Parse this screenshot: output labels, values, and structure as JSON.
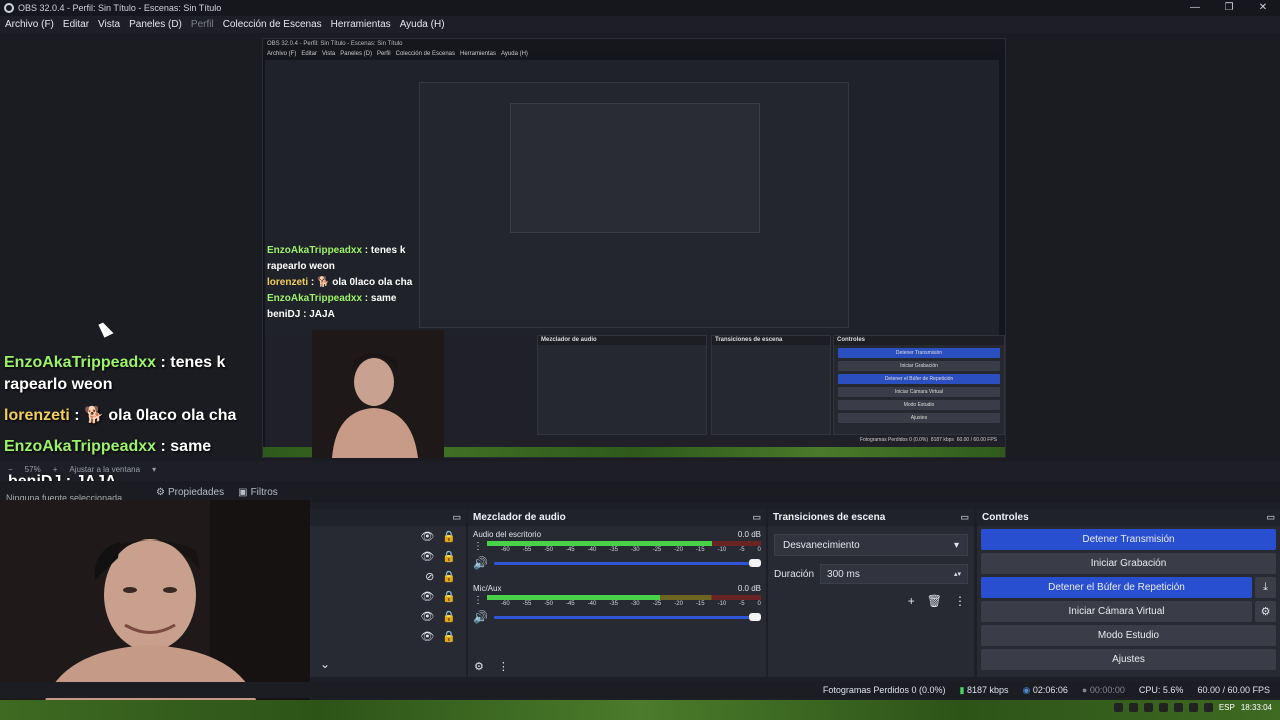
{
  "window": {
    "title": "OBS 32.0.4 - Perfil: Sin Título - Escenas: Sin Título",
    "controls": [
      "—",
      "❐",
      "✕"
    ]
  },
  "menu": [
    {
      "label": "Archivo (F)",
      "enabled": true
    },
    {
      "label": "Editar",
      "enabled": true
    },
    {
      "label": "Vista",
      "enabled": true
    },
    {
      "label": "Paneles (D)",
      "enabled": true
    },
    {
      "label": "Perfil",
      "enabled": false
    },
    {
      "label": "Colección de Escenas",
      "enabled": true
    },
    {
      "label": "Herramientas",
      "enabled": true
    },
    {
      "label": "Ayuda (H)",
      "enabled": true
    }
  ],
  "chat": [
    {
      "user": "EnzoAkaTrippeadxx",
      "sep": " : ",
      "message": "tenes k rapearlo weon",
      "color": "#9cf26a"
    },
    {
      "user": "lorenzeti",
      "sep": " : ",
      "emote": "🐕",
      "message": "ola 0laco ola cha",
      "color": "#f2ce5a"
    },
    {
      "user": "EnzoAkaTrippeadxx",
      "sep": " : ",
      "message": "same",
      "color": "#9cf26a"
    },
    {
      "user": "beniDJ",
      "sep": " : ",
      "message": "JAJA",
      "color": "#ffffff"
    }
  ],
  "zoom": {
    "percent": "57%",
    "fit_label": "Ajustar a la ventana"
  },
  "source_toolbar": {
    "none_selected": "Ninguna fuente seleccionada",
    "properties": "Propiedades",
    "filters": "Filtros"
  },
  "docks": {
    "mixer": {
      "title": "Mezclador de audio",
      "channels": [
        {
          "name": "Audio del escritorio",
          "db": "0.0 dB",
          "level": 0.82
        },
        {
          "name": "Mic/Aux",
          "db": "0.0 dB",
          "level": 0.63
        }
      ],
      "ticks": [
        "-60",
        "-55",
        "-50",
        "-45",
        "-40",
        "-35",
        "-30",
        "-25",
        "-20",
        "-15",
        "-10",
        "-5",
        "0"
      ]
    },
    "transitions": {
      "title": "Transiciones de escena",
      "selected": "Desvanecimiento",
      "duration_label": "Duración",
      "duration_value": "300 ms"
    },
    "controls": {
      "title": "Controles",
      "stop_stream": "Detener Transmisión",
      "start_recording": "Iniciar Grabación",
      "stop_replay": "Detener el Búfer de Repetición",
      "start_virtual_cam": "Iniciar Cámara Virtual",
      "studio_mode": "Modo Estudio",
      "settings": "Ajustes"
    }
  },
  "status": {
    "dropped_frames": "Fotogramas Perdidos 0 (0.0%)",
    "bitrate": "8187 kbps",
    "stream_time": "02:06:06",
    "record_time": "00:00:00",
    "cpu": "CPU: 5.6%",
    "fps": "60.00 / 60.00 FPS"
  },
  "taskbar": {
    "lang": "ESP",
    "clock": "18:33:04"
  },
  "colors": {
    "accent_blue": "#284fd0",
    "bg": "#1e1f26",
    "dock": "#272a33"
  }
}
